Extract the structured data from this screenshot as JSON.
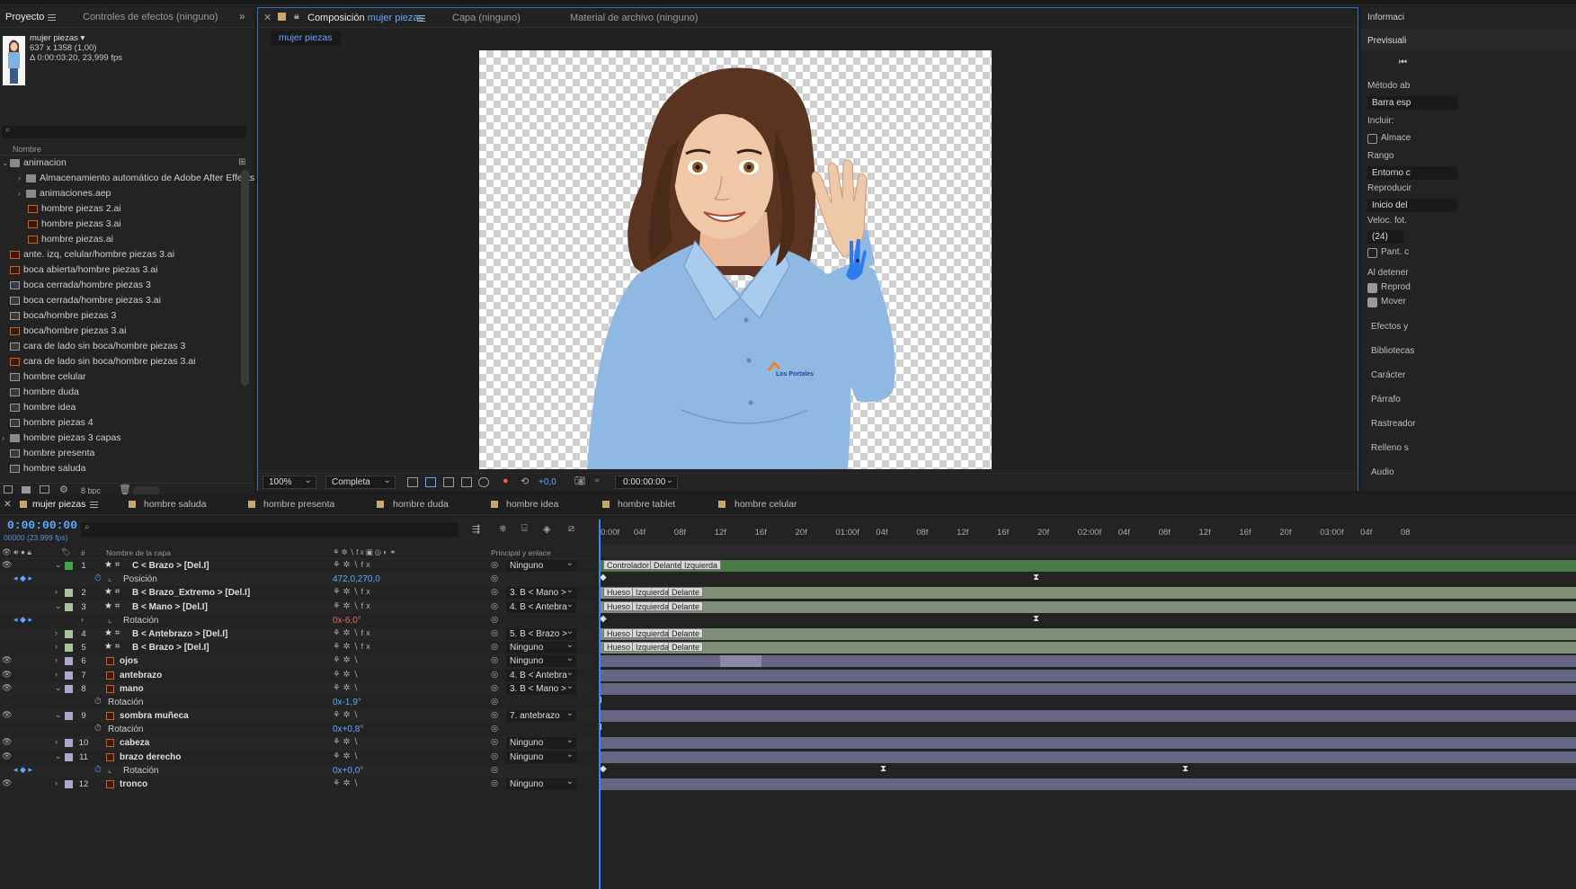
{
  "project": {
    "tabs": [
      "Proyecto",
      "Controles de efectos (ninguno)"
    ],
    "selected_name": "mujer piezas ▾",
    "selected_size": "637 x 1358 (1,00)",
    "selected_duration": "Δ 0:00:03:20, 23,999 fps",
    "column_name": "Nombre",
    "bpc": "8 bpc",
    "items": [
      {
        "name": "animacion",
        "type": "folder",
        "indent": 0,
        "twirl": "⌄"
      },
      {
        "name": "Almacenamiento automático de Adobe After Effects",
        "type": "folder",
        "indent": 1,
        "twirl": "›"
      },
      {
        "name": "animaciones.aep",
        "type": "folder",
        "indent": 1,
        "twirl": "›"
      },
      {
        "name": "hombre piezas 2.ai",
        "type": "ai",
        "indent": 2
      },
      {
        "name": "hombre piezas 3.ai",
        "type": "ai",
        "indent": 2
      },
      {
        "name": "hombre piezas.ai",
        "type": "ai",
        "indent": 2
      },
      {
        "name": "ante. izq, celular/hombre piezas 3.ai",
        "type": "ai",
        "indent": 0
      },
      {
        "name": "boca abierta/hombre piezas 3.ai",
        "type": "ai",
        "indent": 0
      },
      {
        "name": "boca cerrada/hombre piezas 3",
        "type": "comp",
        "indent": 0
      },
      {
        "name": "boca cerrada/hombre piezas 3.ai",
        "type": "comp",
        "indent": 0
      },
      {
        "name": "boca/hombre piezas 3",
        "type": "comp",
        "indent": 0
      },
      {
        "name": "boca/hombre piezas 3.ai",
        "type": "ai",
        "indent": 0
      },
      {
        "name": "cara de lado sin boca/hombre piezas 3",
        "type": "comp",
        "indent": 0
      },
      {
        "name": "cara de lado sin boca/hombre piezas 3.ai",
        "type": "ai",
        "indent": 0
      },
      {
        "name": "hombre celular",
        "type": "comp",
        "indent": 0
      },
      {
        "name": "hombre duda",
        "type": "comp",
        "indent": 0
      },
      {
        "name": "hombre idea",
        "type": "comp",
        "indent": 0
      },
      {
        "name": "hombre piezas 4",
        "type": "comp",
        "indent": 0
      },
      {
        "name": "hombre piezas 3 capas",
        "type": "folder",
        "indent": 0,
        "twirl": "›"
      },
      {
        "name": "hombre presenta",
        "type": "comp",
        "indent": 0
      },
      {
        "name": "hombre saluda",
        "type": "comp",
        "indent": 0
      }
    ]
  },
  "composition": {
    "tab_prefix": "Composición",
    "tab_name": "mujer piezas",
    "other_tabs": [
      "Capa (ninguno)",
      "Material de archivo (ninguno)"
    ],
    "subtab": "mujer piezas",
    "zoom": "100%",
    "resolution": "Completa",
    "exposure": "+0,0",
    "timecode": "0:00:00:00",
    "logo_text": "Los Portales"
  },
  "right_panel": {
    "info": "Informaci",
    "preview": "Previsuali",
    "method_label": "Método ab",
    "method_value": "Barra esp",
    "include": "Incluir:",
    "cache": "Almace",
    "range_label": "Rango",
    "range_value": "Entorno c",
    "playback_label": "Reproducir",
    "playback_value": "Inicio del",
    "fps_label": "Veloc. fot.",
    "fps_value": "(24)",
    "fullscreen": "Pant. c",
    "on_stop": "Al detener",
    "reproduce": "Reprod",
    "move": "Mover",
    "panels": [
      "Efectos y",
      "Bibliotecas",
      "Carácter",
      "Párrafo",
      "Rastreador",
      "Relleno s",
      "Audio"
    ]
  },
  "timeline": {
    "tabs": [
      "mujer piezas",
      "hombre saluda",
      "hombre presenta",
      "hombre duda",
      "hombre idea",
      "hombre tablet",
      "hombre celular"
    ],
    "timecode": "0:00:00:00",
    "frames": "00000 (23.999 fps)",
    "col_layer_name": "Nombre de la capa",
    "col_parent": "Principal y enlace",
    "col_hash": "#",
    "ticks": [
      "0:00f",
      "04f",
      "08f",
      "12f",
      "16f",
      "20f",
      "01:00f",
      "04f",
      "08f",
      "12f",
      "16f",
      "20f",
      "02:00f",
      "04f",
      "08f",
      "12f",
      "16f",
      "20f",
      "03:00f",
      "04f",
      "08"
    ],
    "layers": [
      {
        "kind": "layer",
        "num": "1",
        "name": "C < Brazo > [Del.I]",
        "type": "shape",
        "label": "#3fa845",
        "parent": "Ninguno",
        "twirl": "⌄",
        "eye": true,
        "fx": true
      },
      {
        "kind": "prop",
        "name": "Posición",
        "value": "472,0,270,0",
        "stopwatch": true,
        "kf": true
      },
      {
        "kind": "layer",
        "num": "2",
        "name": "B < Brazo_Extremo > [Del.I]",
        "type": "shape",
        "label": "#a6c49a",
        "parent": "3. B < Mano >",
        "twirl": "›",
        "eye": false,
        "fx": true
      },
      {
        "kind": "layer",
        "num": "3",
        "name": "B < Mano > [Del.I]",
        "type": "shape",
        "label": "#a6c49a",
        "parent": "4. B < Antebra",
        "twirl": "⌄",
        "eye": false,
        "fx": true
      },
      {
        "kind": "prop",
        "name": "Rotación",
        "value": "0x-6,0°",
        "red": true,
        "stopwatch": false,
        "kf": true,
        "sub": true
      },
      {
        "kind": "layer",
        "num": "4",
        "name": "B < Antebrazo > [Del.I]",
        "type": "shape",
        "label": "#a6c49a",
        "parent": "5. B < Brazo >",
        "twirl": "›",
        "eye": false,
        "fx": true
      },
      {
        "kind": "layer",
        "num": "5",
        "name": "B < Brazo > [Del.I]",
        "type": "shape",
        "label": "#a6c49a",
        "parent": "Ninguno",
        "twirl": "›",
        "eye": false,
        "fx": true
      },
      {
        "kind": "layer",
        "num": "6",
        "name": "ojos",
        "type": "ai",
        "label": "#a9a7d4",
        "parent": "Ninguno",
        "twirl": "›",
        "eye": true
      },
      {
        "kind": "layer",
        "num": "7",
        "name": "antebrazo",
        "type": "ai",
        "label": "#a9a7d4",
        "parent": "4. B < Antebra",
        "twirl": "›",
        "eye": true
      },
      {
        "kind": "layer",
        "num": "8",
        "name": "mano",
        "type": "ai",
        "label": "#a9a7d4",
        "parent": "3. B < Mano >",
        "twirl": "⌄",
        "eye": true
      },
      {
        "kind": "prop",
        "name": "Rotación",
        "value": "0x-1,9°",
        "stopwatch": false,
        "kf": false,
        "nostop": true
      },
      {
        "kind": "layer",
        "num": "9",
        "name": "sombra muñeca",
        "type": "ai",
        "label": "#a9a7d4",
        "parent": "7. antebrazo",
        "twirl": "⌄",
        "eye": true
      },
      {
        "kind": "prop",
        "name": "Rotación",
        "value": "0x+0,8°",
        "stopwatch": false,
        "kf": false,
        "nostop": true
      },
      {
        "kind": "layer",
        "num": "10",
        "name": "cabeza",
        "type": "ai",
        "label": "#a9a7d4",
        "parent": "Ninguno",
        "twirl": "›",
        "eye": true
      },
      {
        "kind": "layer",
        "num": "11",
        "name": "brazo derecho",
        "type": "ai",
        "label": "#a9a7d4",
        "parent": "Ninguno",
        "twirl": "⌄",
        "eye": true
      },
      {
        "kind": "prop",
        "name": "Rotación",
        "value": "0x+0,0°",
        "stopwatch": true,
        "kf": true
      },
      {
        "kind": "layer",
        "num": "12",
        "name": "tronco",
        "type": "ai",
        "label": "#a9a7d4",
        "parent": "Ninguno",
        "twirl": "›",
        "eye": true
      }
    ],
    "markers": {
      "controller": [
        "Controlador",
        "Delante",
        "Izquierda"
      ],
      "bone": [
        "Hueso",
        "Izquierda",
        "Delante"
      ]
    }
  }
}
